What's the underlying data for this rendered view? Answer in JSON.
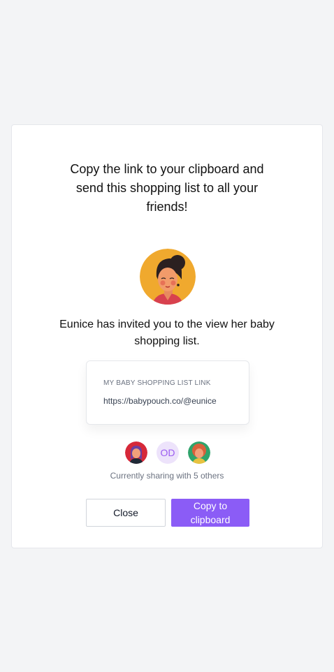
{
  "modal": {
    "headline": "Copy the link to your clipboard and send this shopping list to all your friends!",
    "invite_text": "Eunice has invited you to the view her baby shopping list.",
    "link_label": "MY BABY SHOPPING LIST LINK",
    "link_url": "https://babypouch.co/@eunice",
    "sharer_initials": "OD",
    "sharing_text": "Currently sharing with 5 others",
    "close_label": "Close",
    "copy_label": "Copy to clipboard"
  },
  "colors": {
    "accent": "#8b5cf6",
    "background": "#f3f4f6",
    "avatar_bg": "#f0a92e"
  },
  "icons": [
    "avatar-eunice",
    "avatar-sharer-1",
    "avatar-sharer-3"
  ]
}
